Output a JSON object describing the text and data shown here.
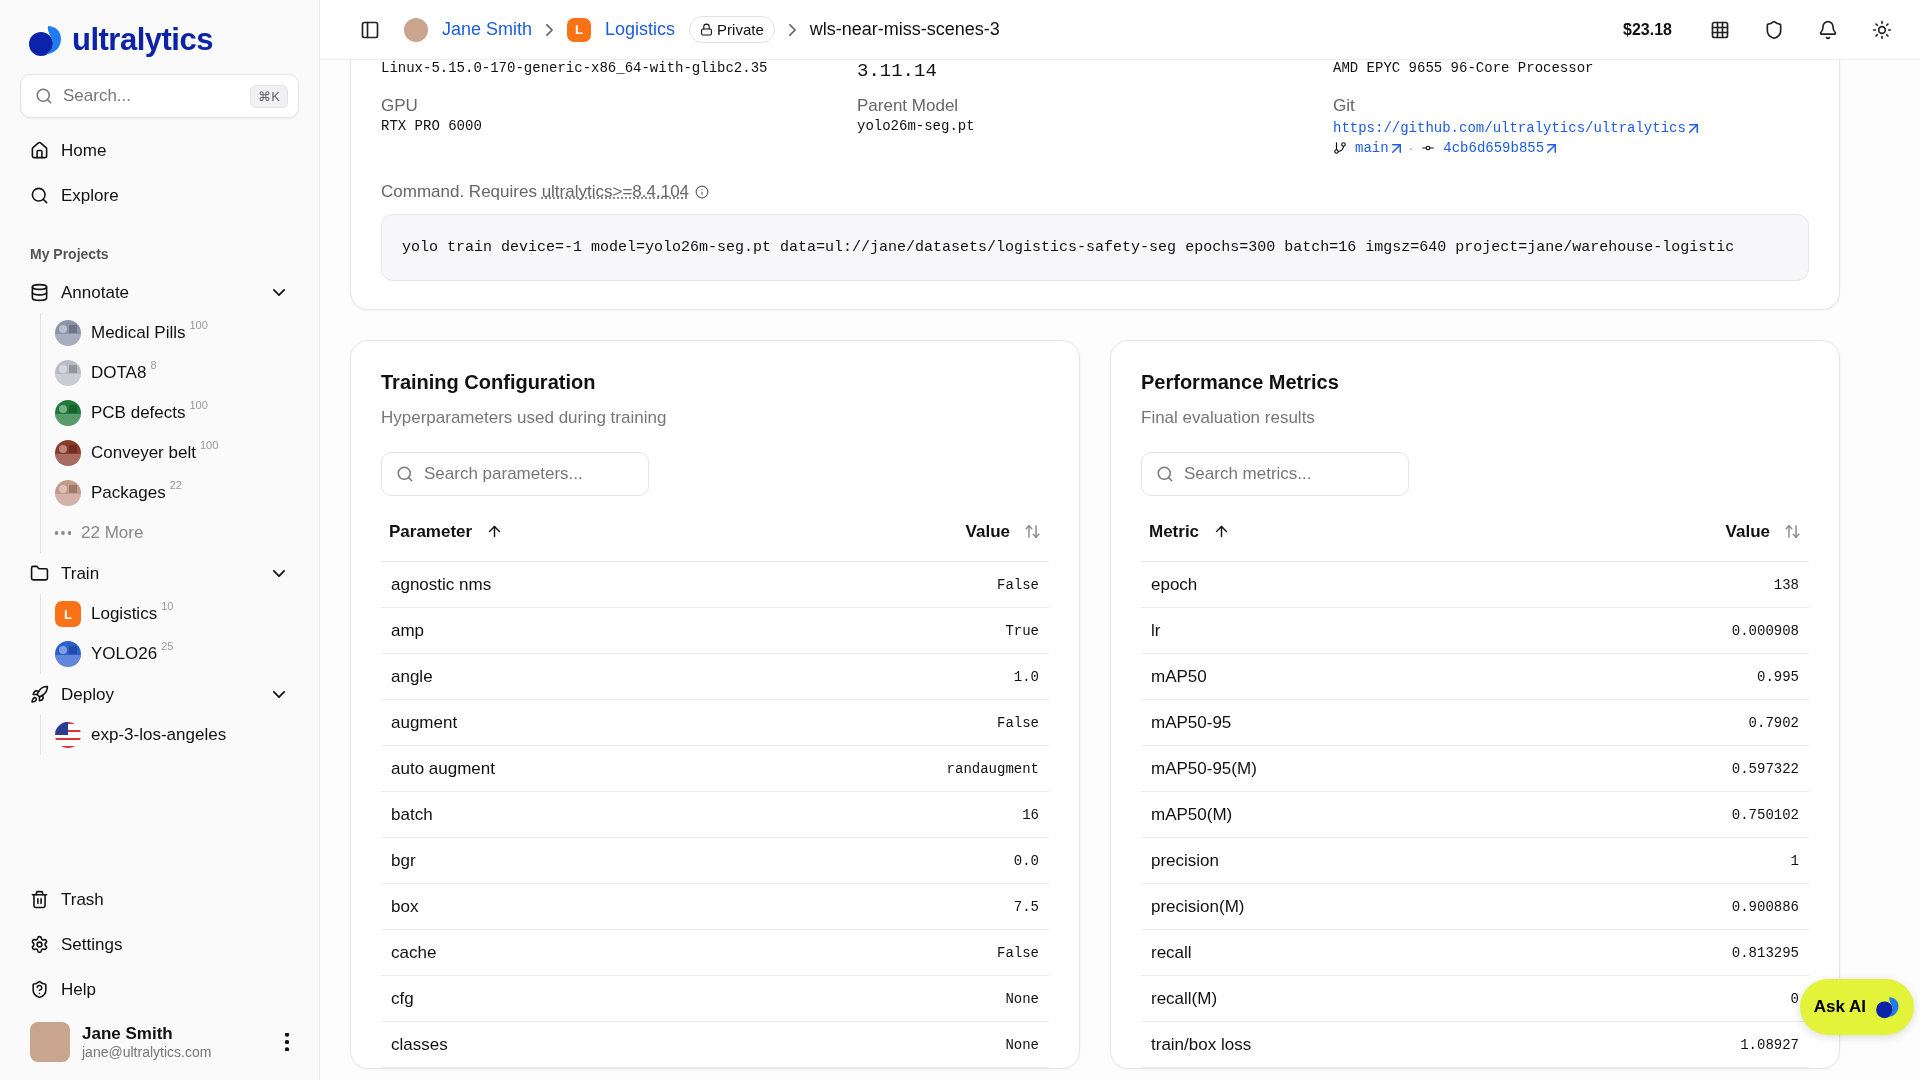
{
  "sidebar": {
    "brand": "ultralytics",
    "search": {
      "placeholder": "Search...",
      "shortcut": "⌘K"
    },
    "nav": [
      {
        "label": "Home"
      },
      {
        "label": "Explore"
      }
    ],
    "section_title": "My Projects",
    "groups": [
      {
        "label": "Annotate",
        "expanded": true,
        "items": [
          {
            "label": "Medical Pills",
            "count": "100",
            "color": "#8a93a8"
          },
          {
            "label": "DOTA8",
            "count": "8",
            "color": "#b8bcc4"
          },
          {
            "label": "PCB defects",
            "count": "100",
            "color": "#1f7a3a"
          },
          {
            "label": "Conveyer belt",
            "count": "100",
            "color": "#8a3b2a"
          },
          {
            "label": "Packages",
            "count": "22",
            "color": "#c49a8a"
          },
          {
            "label": "22 More",
            "kind": "more"
          }
        ]
      },
      {
        "label": "Train",
        "expanded": true,
        "items": [
          {
            "label": "Logistics",
            "count": "10",
            "kind": "letter",
            "letter": "L",
            "color": "#f97316"
          },
          {
            "label": "YOLO26",
            "count": "25",
            "color": "#2b5fd0"
          }
        ]
      },
      {
        "label": "Deploy",
        "expanded": true,
        "items": [
          {
            "label": "exp-3-los-angeles",
            "kind": "flag"
          }
        ]
      }
    ],
    "bottom_nav": [
      {
        "label": "Trash"
      },
      {
        "label": "Settings"
      },
      {
        "label": "Help"
      }
    ],
    "user": {
      "name": "Jane Smith",
      "email": "jane@ultralytics.com"
    }
  },
  "topbar": {
    "breadcrumbs": [
      {
        "label": "Jane Smith",
        "kind": "user"
      },
      {
        "label": "Logistics",
        "kind": "project",
        "letter": "L"
      },
      {
        "label": "wls-near-miss-scenes-3",
        "kind": "current"
      }
    ],
    "badge": "Private",
    "balance": "$23.18"
  },
  "env_card": {
    "fields": [
      {
        "value": "Linux-5.15.0-170-generic-x86_64-with-glibc2.35",
        "kind": "mono"
      },
      {
        "value": "3.11.14",
        "kind": "large"
      },
      {
        "value": "AMD EPYC 9655 96-Core Processor",
        "kind": "mono"
      },
      {
        "label": "GPU",
        "value": "RTX PRO 6000",
        "kind": "mono"
      },
      {
        "label": "Parent Model",
        "value": "yolo26m-seg.pt",
        "kind": "mono"
      },
      {
        "label": "Git",
        "value": "https://github.com/ultralytics/ultralytics",
        "kind": "link",
        "branch": "main",
        "separator": "·",
        "commit": "4cb6d659b855"
      }
    ],
    "command_label": "Command. Requires",
    "command_req": "ultralytics>=8.4.104",
    "command": "yolo train device=-1 model=yolo26m-seg.pt data=ul://jane/datasets/logistics-safety-seg epochs=300 batch=16 imgsz=640 project=jane/warehouse-logistic"
  },
  "panels": [
    {
      "title": "Training Configuration",
      "subtitle": "Hyperparameters used during training",
      "search_placeholder": "Search parameters...",
      "columns": [
        "Parameter",
        "Value"
      ],
      "rows": [
        [
          "agnostic nms",
          "False"
        ],
        [
          "amp",
          "True"
        ],
        [
          "angle",
          "1.0"
        ],
        [
          "augment",
          "False"
        ],
        [
          "auto augment",
          "randaugment"
        ],
        [
          "batch",
          "16"
        ],
        [
          "bgr",
          "0.0"
        ],
        [
          "box",
          "7.5"
        ],
        [
          "cache",
          "False"
        ],
        [
          "cfg",
          "None"
        ],
        [
          "classes",
          "None"
        ]
      ]
    },
    {
      "title": "Performance Metrics",
      "subtitle": "Final evaluation results",
      "search_placeholder": "Search metrics...",
      "columns": [
        "Metric",
        "Value"
      ],
      "rows": [
        [
          "epoch",
          "138"
        ],
        [
          "lr",
          "0.000908"
        ],
        [
          "mAP50",
          "0.995"
        ],
        [
          "mAP50-95",
          "0.7902"
        ],
        [
          "mAP50-95(M)",
          "0.597322"
        ],
        [
          "mAP50(M)",
          "0.750102"
        ],
        [
          "precision",
          "1"
        ],
        [
          "precision(M)",
          "0.900886"
        ],
        [
          "recall",
          "0.813295"
        ],
        [
          "recall(M)",
          "0"
        ],
        [
          "train/box loss",
          "1.08927"
        ]
      ]
    }
  ],
  "ask_ai": "Ask AI"
}
